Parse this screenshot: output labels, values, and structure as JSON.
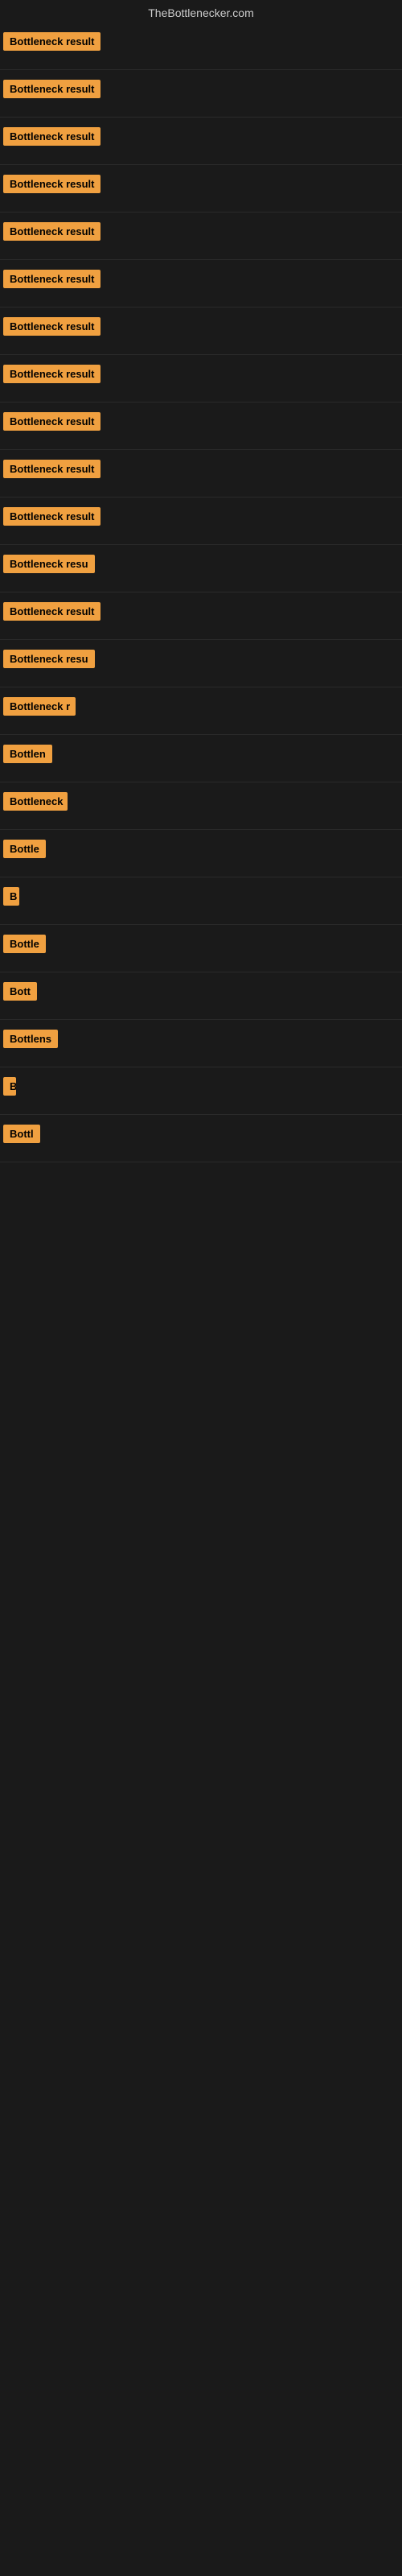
{
  "site": {
    "title": "TheBottlenecker.com"
  },
  "results": [
    {
      "id": 1,
      "label": "Bottleneck result",
      "badge_width": 130
    },
    {
      "id": 2,
      "label": "Bottleneck result",
      "badge_width": 130
    },
    {
      "id": 3,
      "label": "Bottleneck result",
      "badge_width": 130
    },
    {
      "id": 4,
      "label": "Bottleneck result",
      "badge_width": 130
    },
    {
      "id": 5,
      "label": "Bottleneck result",
      "badge_width": 130
    },
    {
      "id": 6,
      "label": "Bottleneck result",
      "badge_width": 130
    },
    {
      "id": 7,
      "label": "Bottleneck result",
      "badge_width": 130
    },
    {
      "id": 8,
      "label": "Bottleneck result",
      "badge_width": 130
    },
    {
      "id": 9,
      "label": "Bottleneck result",
      "badge_width": 130
    },
    {
      "id": 10,
      "label": "Bottleneck result",
      "badge_width": 130
    },
    {
      "id": 11,
      "label": "Bottleneck result",
      "badge_width": 130
    },
    {
      "id": 12,
      "label": "Bottleneck resu",
      "badge_width": 115
    },
    {
      "id": 13,
      "label": "Bottleneck result",
      "badge_width": 130
    },
    {
      "id": 14,
      "label": "Bottleneck resu",
      "badge_width": 115
    },
    {
      "id": 15,
      "label": "Bottleneck r",
      "badge_width": 90
    },
    {
      "id": 16,
      "label": "Bottlen",
      "badge_width": 65
    },
    {
      "id": 17,
      "label": "Bottleneck",
      "badge_width": 80
    },
    {
      "id": 18,
      "label": "Bottle",
      "badge_width": 55
    },
    {
      "id": 19,
      "label": "B",
      "badge_width": 20
    },
    {
      "id": 20,
      "label": "Bottle",
      "badge_width": 55
    },
    {
      "id": 21,
      "label": "Bott",
      "badge_width": 42
    },
    {
      "id": 22,
      "label": "Bottlens",
      "badge_width": 68
    },
    {
      "id": 23,
      "label": "B",
      "badge_width": 14
    },
    {
      "id": 24,
      "label": "Bottl",
      "badge_width": 48
    }
  ]
}
